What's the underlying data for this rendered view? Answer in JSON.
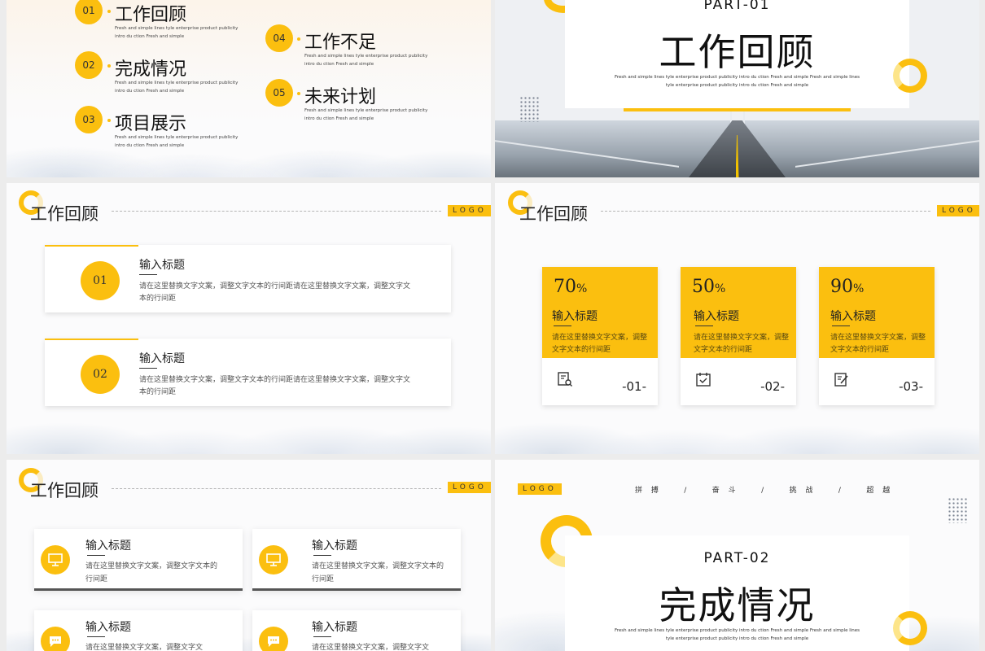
{
  "colors": {
    "accent": "#fbbf0f",
    "text": "#222222"
  },
  "agenda": {
    "items": [
      {
        "num": "01",
        "title": "工作回顾",
        "desc": "Fresh and simple lines tyle enterprise product publicity intro du ction Fresh and simple"
      },
      {
        "num": "02",
        "title": "完成情况",
        "desc": "Fresh and simple lines tyle enterprise product publicity intro du ction Fresh and simple"
      },
      {
        "num": "03",
        "title": "项目展示",
        "desc": "Fresh and simple lines tyle enterprise product publicity intro du ction Fresh and simple"
      },
      {
        "num": "04",
        "title": "工作不足",
        "desc": "Fresh and simple lines tyle enterprise product publicity intro du ction Fresh and simple"
      },
      {
        "num": "05",
        "title": "未来计划",
        "desc": "Fresh and simple lines tyle enterprise product publicity intro du ction Fresh and simple"
      }
    ]
  },
  "part1": {
    "label": "PART-01",
    "title": "工作回顾",
    "desc": "Fresh and simple lines tyle enterprise product publicity intro du ction Fresh and simple Fresh and simple lines tyle enterprise product publicity intro du ction Fresh and simple"
  },
  "review_slide_a": {
    "title": "工作回顾",
    "logo": "LOGO",
    "items": [
      {
        "num": "01",
        "title": "输入标题",
        "desc": "请在这里替换文字文案，调整文字文本的行间距请在这里替换文字文案，调整文字文本的行间距"
      },
      {
        "num": "02",
        "title": "输入标题",
        "desc": "请在这里替换文字文案，调整文字文本的行间距请在这里替换文字文案，调整文字文本的行间距"
      }
    ]
  },
  "review_slide_b": {
    "title": "工作回顾",
    "logo": "LOGO",
    "cards": [
      {
        "percent": "70",
        "unit": "%",
        "title": "输入标题",
        "desc": "请在这里替换文字文案，调整文字文本的行间距",
        "num": "-01-",
        "icon": "document-search-icon"
      },
      {
        "percent": "50",
        "unit": "%",
        "title": "输入标题",
        "desc": "请在这里替换文字文案，调整文字文本的行间距",
        "num": "-02-",
        "icon": "calendar-check-icon"
      },
      {
        "percent": "90",
        "unit": "%",
        "title": "输入标题",
        "desc": "请在这里替换文字文案，调整文字文本的行间距",
        "num": "-03-",
        "icon": "edit-note-icon"
      }
    ]
  },
  "review_slide_c": {
    "title": "工作回顾",
    "logo": "LOGO",
    "cards": [
      {
        "title": "输入标题",
        "desc": "请在这里替换文字文案，调整文字文本的行间距",
        "icon": "presentation-icon"
      },
      {
        "title": "输入标题",
        "desc": "请在这里替换文字文案，调整文字文本的行间距",
        "icon": "presentation-icon"
      },
      {
        "title": "输入标题",
        "desc": "请在这里替换文字文案，调整文字文",
        "icon": "chat-icon"
      },
      {
        "title": "输入标题",
        "desc": "请在这里替换文字文案，调整文字文",
        "icon": "chat-icon"
      }
    ]
  },
  "part2": {
    "logo": "LOGO",
    "motto": "拼 搏    /    奋 斗    /    挑 战    /    超 越",
    "label": "PART-02",
    "title": "完成情况",
    "desc": "Fresh and simple lines tyle enterprise product publicity intro du ction Fresh and simple Fresh and simple lines tyle enterprise product publicity intro du ction Fresh and simple"
  }
}
